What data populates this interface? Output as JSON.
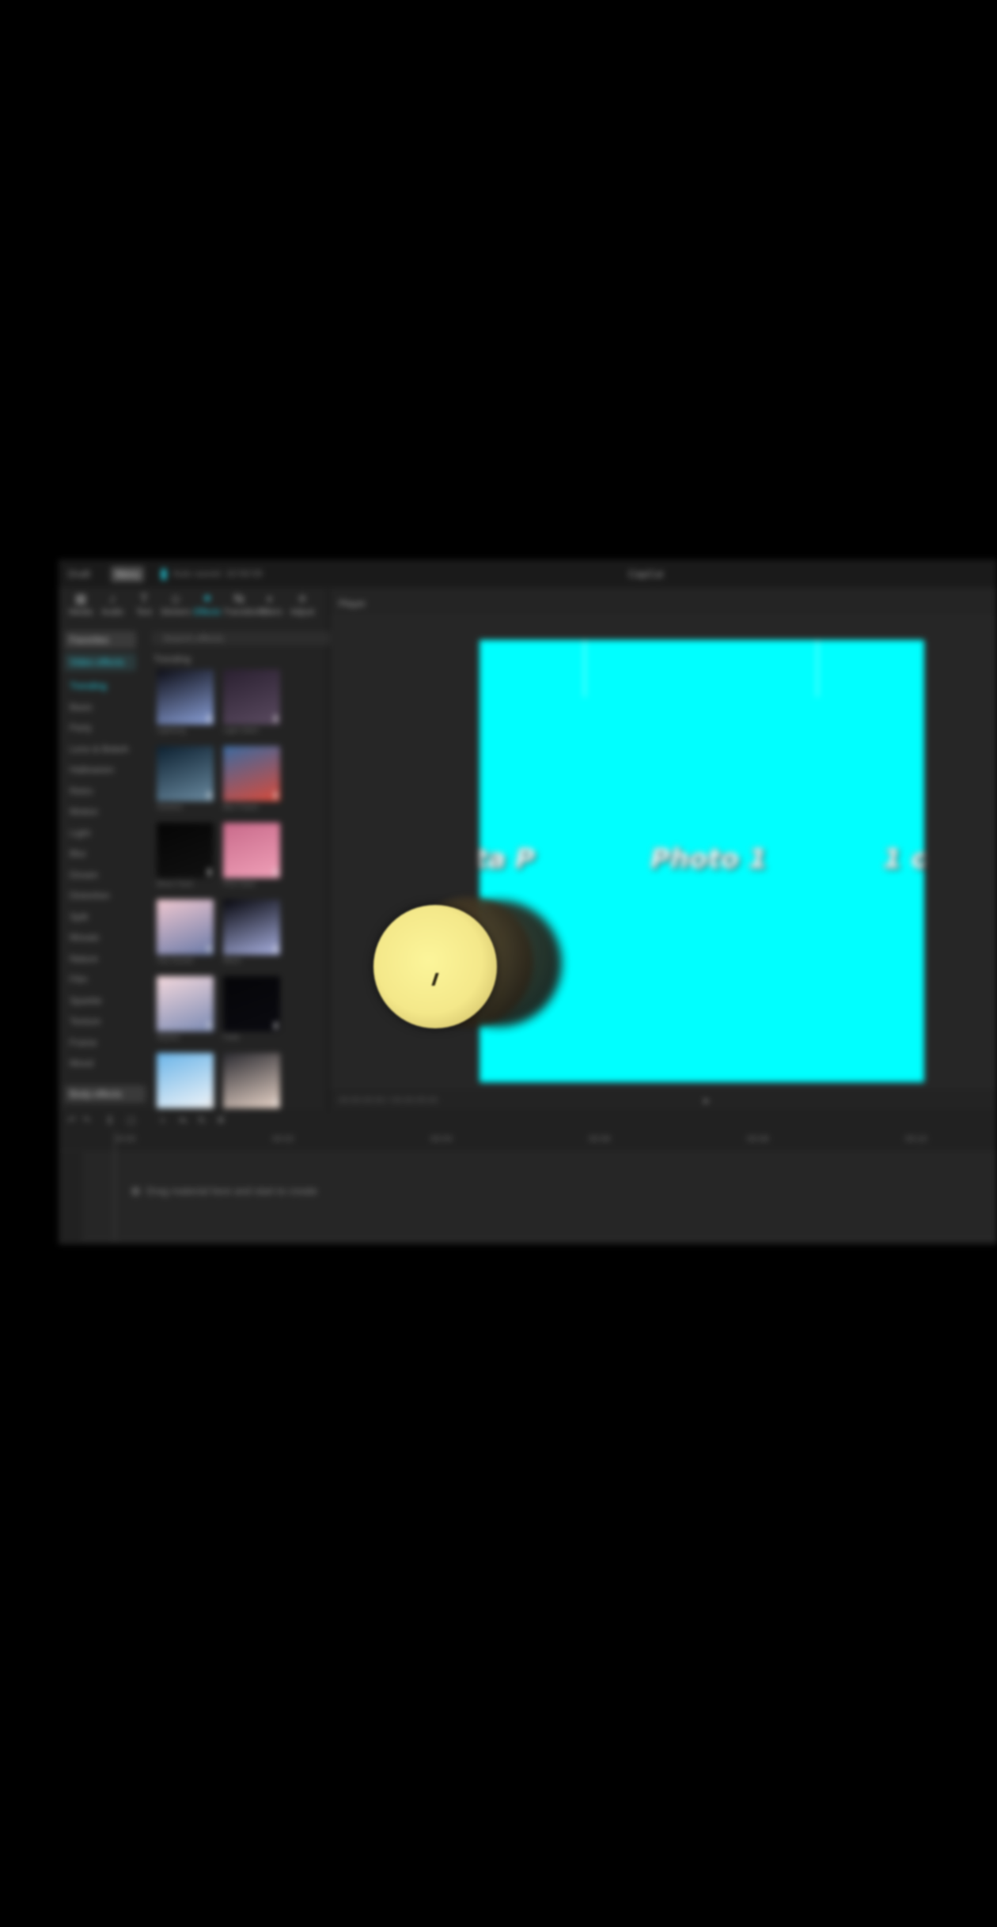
{
  "titlebar": {
    "project_name": "Draft",
    "menu_badge": "Menu",
    "autosave": "Auto saved: 16:58:09",
    "app_title": "CapCut"
  },
  "tool_tabs": [
    {
      "label": "Media",
      "icon": "media-icon",
      "active": false
    },
    {
      "label": "Audio",
      "icon": "audio-icon",
      "active": false
    },
    {
      "label": "Text",
      "icon": "text-icon",
      "active": false
    },
    {
      "label": "Stickers",
      "icon": "sticker-icon",
      "active": false
    },
    {
      "label": "Effects",
      "icon": "effects-icon",
      "active": true
    },
    {
      "label": "Transitions",
      "icon": "transition-icon",
      "active": false
    },
    {
      "label": "Filters",
      "icon": "filters-icon",
      "active": false
    },
    {
      "label": "Adjust",
      "icon": "adjust-icon",
      "active": false
    }
  ],
  "categories": {
    "header": "Favorites",
    "second_header": "Video effects",
    "items": [
      "Trending",
      "Basic",
      "Party",
      "Lens & Bokeh",
      "Halloween",
      "Retro",
      "Motion",
      "Light",
      "Blur",
      "Dream",
      "Distortion",
      "Split",
      "Mosaic",
      "Nature",
      "Film",
      "Sparkle",
      "Texture",
      "Frame",
      "Mood",
      "Beauty"
    ],
    "footer": "Body effects"
  },
  "search": {
    "placeholder": "Search effects"
  },
  "section_label": "Trending",
  "media_items": [
    {
      "caption": "Lightning",
      "colors": [
        "#0c0c14",
        "#8aa0d8"
      ]
    },
    {
      "caption": "Light Glitch",
      "colors": [
        "#2a2030",
        "#5a4a60"
      ]
    },
    {
      "caption": "Shadow",
      "colors": [
        "#0c2030",
        "#6a8aa0"
      ]
    },
    {
      "caption": "Blur Frame",
      "colors": [
        "#3a6aa0",
        "#d84a3a"
      ]
    },
    {
      "caption": "Black Flash",
      "colors": [
        "#050505",
        "#111111"
      ]
    },
    {
      "caption": "Pink Glow",
      "colors": [
        "#c86a8a",
        "#f0a0b8"
      ]
    },
    {
      "caption": "City Sunset",
      "colors": [
        "#f0c8d0",
        "#6a7aa8"
      ]
    },
    {
      "caption": "Moon",
      "colors": [
        "#06060c",
        "#a8b0e0"
      ]
    },
    {
      "caption": "Skyline",
      "colors": [
        "#f4d8dc",
        "#7a8ab4"
      ]
    },
    {
      "caption": "Fade",
      "colors": [
        "#050508",
        "#0a0a10"
      ]
    },
    {
      "caption": "Jump",
      "colors": [
        "#6ab4e8",
        "#f0f4f8"
      ]
    },
    {
      "caption": "Portrait",
      "colors": [
        "#2a2a30",
        "#e8d4c8"
      ]
    }
  ],
  "preview": {
    "label": "Player",
    "canvas_color": "#00ffff",
    "photo_labels": [
      "ta P",
      "Photo 1",
      "1 o"
    ],
    "time": "00:00:00:00 / 00:00:05:00"
  },
  "timeline": {
    "tools": [
      "undo",
      "redo",
      "split",
      "delete",
      "crop",
      "mirror",
      "rotate",
      "freeze"
    ],
    "ticks": [
      "00:00",
      "00:02",
      "00:04",
      "00:06",
      "00:08",
      "00:10"
    ],
    "hint": "Drag material here and start to create"
  },
  "colors": {
    "accent": "#22d0e4",
    "background": "#000000",
    "panel": "#232323",
    "touch_cursor": "#f4e88a"
  }
}
